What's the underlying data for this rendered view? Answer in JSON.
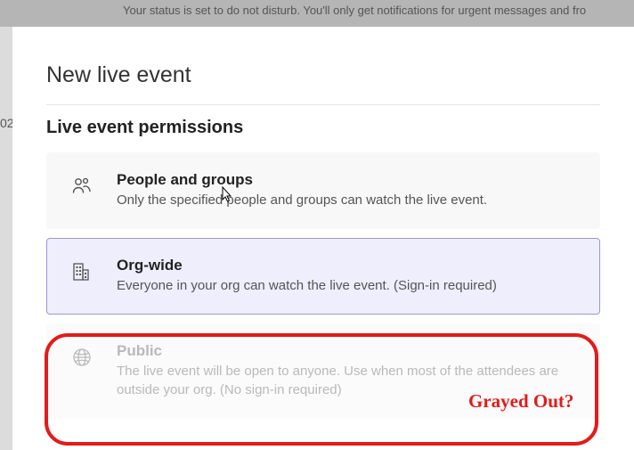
{
  "backdrop_status": "Your status is set to do not disturb. You'll only get notifications for urgent messages and fro",
  "left_strip_number": "02",
  "modal": {
    "title": "New live event",
    "section_heading": "Live event permissions"
  },
  "options": {
    "people_groups": {
      "title": "People and groups",
      "desc": "Only the specified people and groups can watch the live event."
    },
    "org_wide": {
      "title": "Org-wide",
      "desc": "Everyone in your org can watch the live event. (Sign-in required)"
    },
    "public": {
      "title": "Public",
      "desc": "The live event will be open to anyone. Use when most of the attendees are outside your org. (No sign-in required)"
    }
  },
  "annotation": {
    "label": "Grayed Out?"
  }
}
